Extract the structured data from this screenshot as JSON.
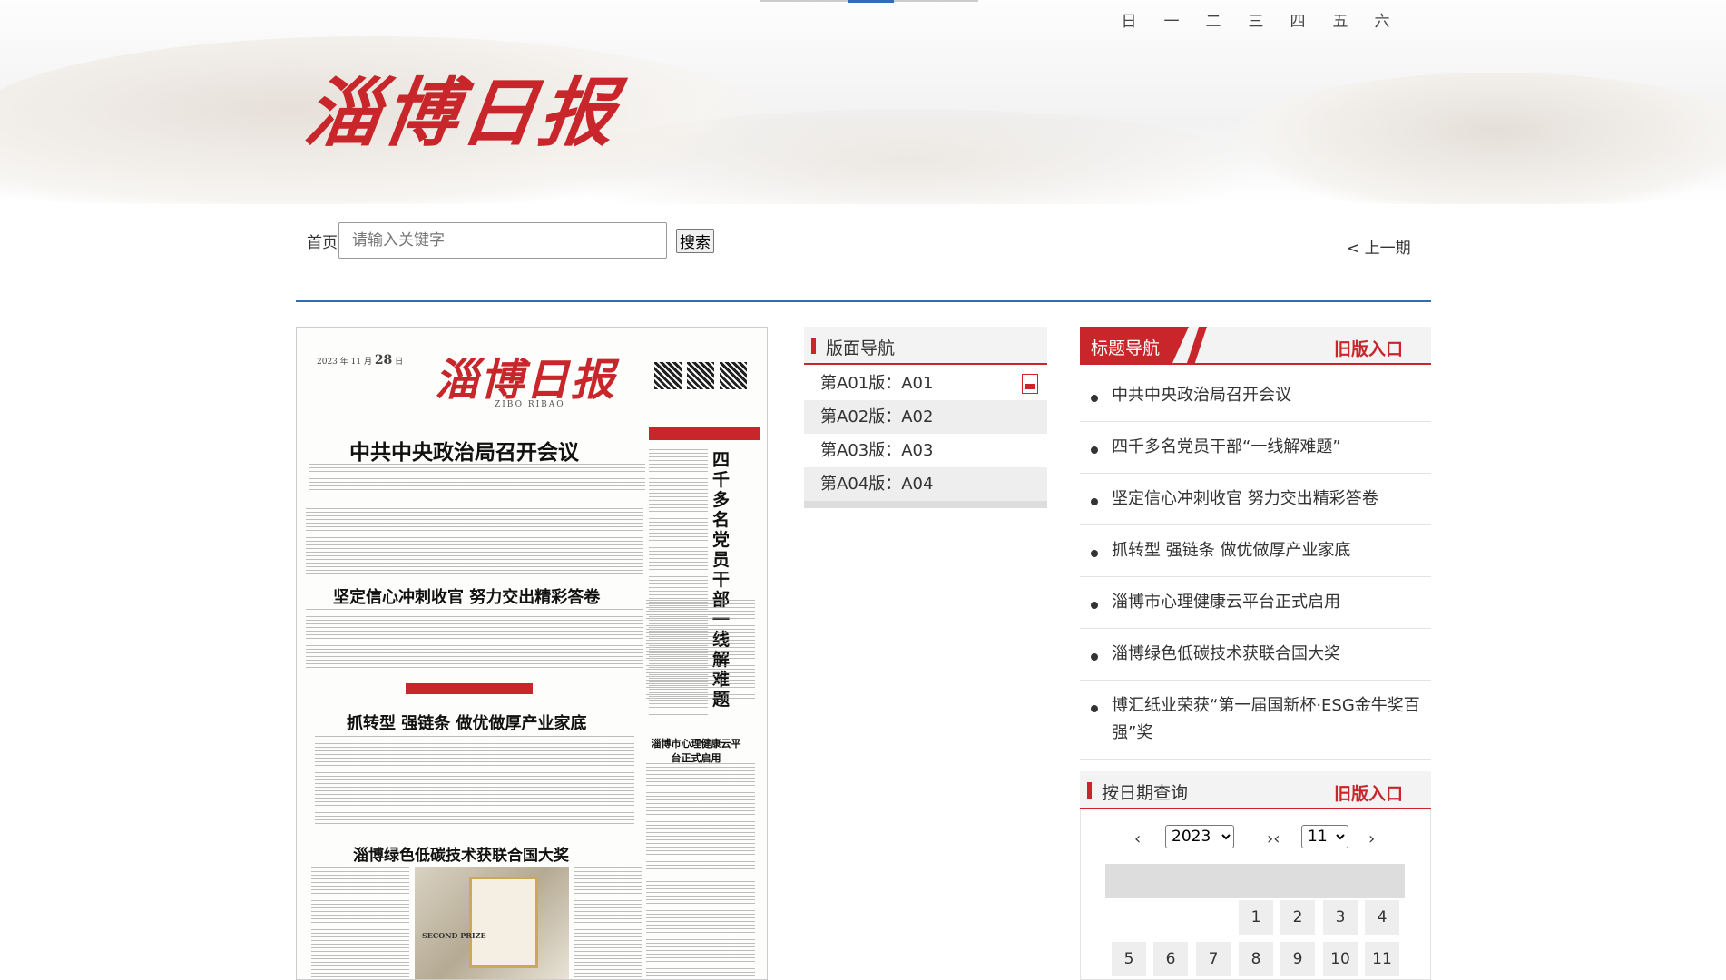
{
  "site": {
    "logo_text": "淄博日报"
  },
  "toolbar": {
    "home_label": "首页",
    "search_placeholder": "请输入关键字",
    "search_button": "搜索",
    "prev_issue": "< 上一期"
  },
  "paper": {
    "masthead": "淄博日报",
    "masthead_sub": "ZIBO RIBAO",
    "date_day": "28",
    "headline_1": "中共中央政治局召开会议",
    "headline_2": "坚定信心冲刺收官    努力交出精彩答卷",
    "headline_3": "抓转型 强链条 做优做厚产业家底",
    "headline_4": "淄博绿色低碳技术获联合国大奖",
    "headline_5": "淄博市心理健康云平台正式启用",
    "vertical_headline": "四千多名党员干部一线解难题",
    "photo_label": "SECOND PRIZE"
  },
  "layout_nav": {
    "title": "版面导航",
    "items": [
      {
        "label": "第A01版：A01",
        "pdf": true
      },
      {
        "label": "第A02版：A02",
        "pdf": false
      },
      {
        "label": "第A03版：A03",
        "pdf": false
      },
      {
        "label": "第A04版：A04",
        "pdf": false
      }
    ]
  },
  "title_nav": {
    "title": "标题导航",
    "old_entry": "旧版入口",
    "items": [
      "中共中央政治局召开会议",
      "四千多名党员干部“一线解难题”",
      "坚定信心冲刺收官 努力交出精彩答卷",
      "抓转型 强链条 做优做厚产业家底",
      "淄博市心理健康云平台正式启用",
      "淄博绿色低碳技术获联合国大奖",
      "博汇纸业荣获“第一届国新杯·ESG金牛奖百强”奖"
    ]
  },
  "date_query": {
    "title": "按日期查询",
    "old_entry": "旧版入口",
    "prev_year": "‹",
    "nav_mid": "›‹",
    "next_month": "›",
    "year": "2023",
    "month": "11",
    "weekdays": [
      "日",
      "一",
      "二",
      "三",
      "四",
      "五",
      "六"
    ],
    "days_row1": [
      "1",
      "2",
      "3",
      "4"
    ],
    "days_row2": [
      "5",
      "6",
      "7",
      "8",
      "9",
      "10",
      "11"
    ]
  }
}
